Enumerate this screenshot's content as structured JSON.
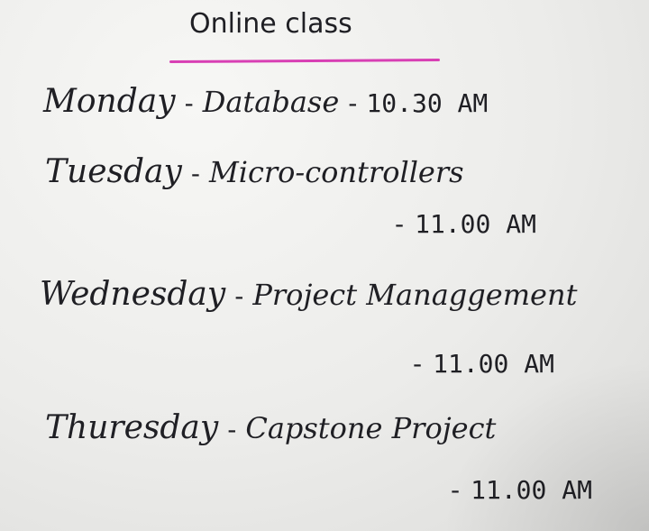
{
  "title": "Online class",
  "entries": [
    {
      "day": "Monday",
      "dash": "-",
      "subject": "Database",
      "separator": "-",
      "time": "10.30 AM"
    },
    {
      "day": "Tuesday",
      "dash": "-",
      "subject": "Micro-controllers",
      "separator": "-",
      "time": "11.00 AM"
    },
    {
      "day": "Wednesday",
      "dash": "-",
      "subject": "Project Managgement",
      "separator": "-",
      "time": "11.00 AM"
    },
    {
      "day": "Thuresday",
      "dash": "-",
      "subject": "Capstone Project",
      "separator": "-",
      "time": "11.00 AM"
    }
  ]
}
